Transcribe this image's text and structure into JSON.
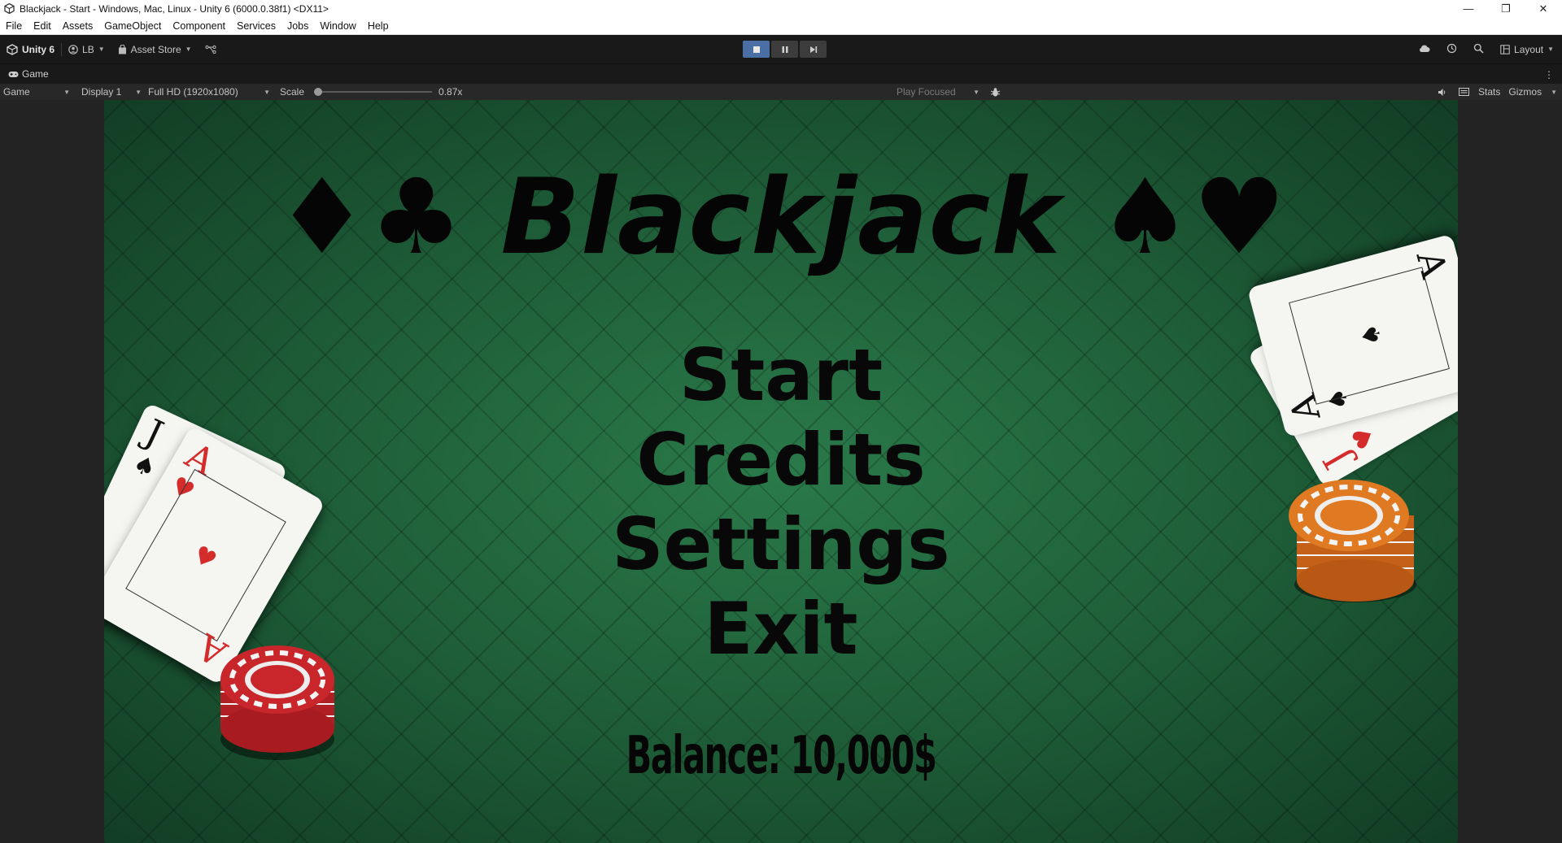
{
  "window": {
    "title": "Blackjack - Start - Windows, Mac, Linux - Unity 6 (6000.0.38f1) <DX11>",
    "controls": [
      "—",
      "❐",
      "✕"
    ]
  },
  "menubar": [
    "File",
    "Edit",
    "Assets",
    "GameObject",
    "Component",
    "Services",
    "Jobs",
    "Window",
    "Help"
  ],
  "toolbar": {
    "unity_label": "Unity 6",
    "account_label": "LB",
    "asset_store_label": "Asset Store",
    "layout_label": "Layout"
  },
  "tab": {
    "label": "Game"
  },
  "gamebar": {
    "view_mode": "Game",
    "display": "Display 1",
    "resolution": "Full HD (1920x1080)",
    "scale_label": "Scale",
    "scale_value": "0.87x",
    "play_mode": "Play Focused",
    "stats_label": "Stats",
    "gizmos_label": "Gizmos"
  },
  "game": {
    "title": "♦♣ Blackjack ♠♥",
    "menu": [
      "Start",
      "Credits",
      "Settings",
      "Exit"
    ],
    "balance": "Balance: 10,000$"
  },
  "colors": {
    "felt": "#1f5e3a",
    "card_red": "#d42b2b",
    "chip_red": "#c8262b",
    "chip_orange": "#e07a22",
    "play_active": "#4a6fa5"
  }
}
